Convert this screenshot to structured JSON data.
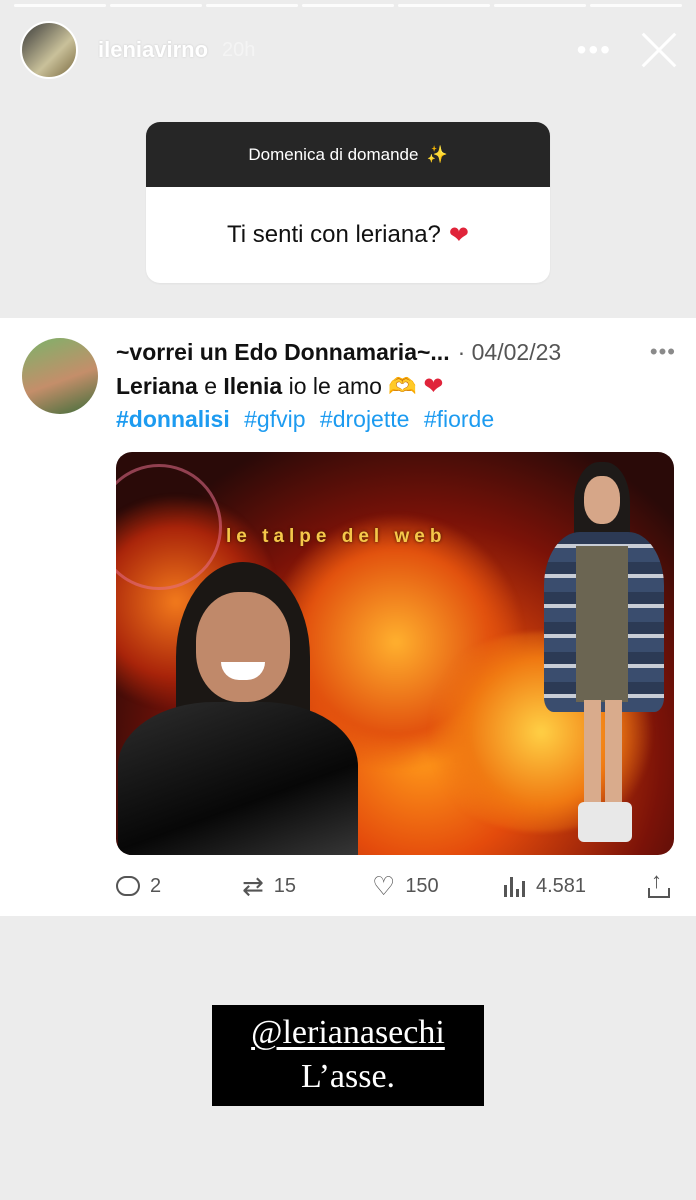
{
  "story": {
    "progress_segments": 7,
    "username": "ileniavirno",
    "time": "20h",
    "more_label": "•••"
  },
  "question_box": {
    "title": "Domenica di domande",
    "title_emoji": "✨",
    "question": "Ti senti con leriana?",
    "question_emoji": "❤"
  },
  "tweet": {
    "name": "~vorrei un Edo Donnamaria~...",
    "date": "· 04/02/23",
    "more_label": "•••",
    "line1": {
      "name1": "Leriana",
      "middle": "e",
      "name2": "Ilenia",
      "tail": "io le amo",
      "emoji_hands": "🫶",
      "emoji_heart": "❤"
    },
    "hashtags": [
      "#donnalisi",
      "#gfvip",
      "#drojette",
      "#fiorde"
    ],
    "image_watermark": "le talpe del web",
    "stats": {
      "replies": "2",
      "retweets": "15",
      "likes": "150",
      "views": "4.581"
    }
  },
  "sticker": {
    "mention": "@lerianasechi",
    "caption": "L’asse."
  },
  "colors": {
    "link": "#1d9bf0",
    "heart": "#e0243a",
    "question_header": "#262626"
  }
}
